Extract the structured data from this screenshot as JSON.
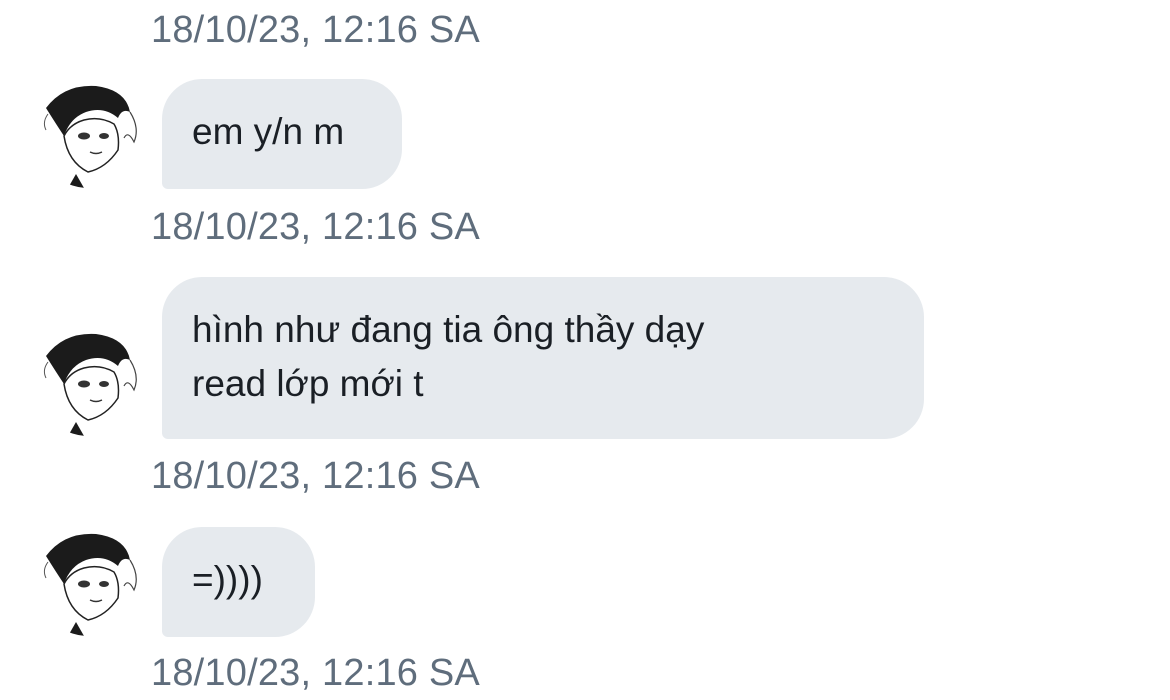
{
  "messages": [
    {
      "text": "em y/n m",
      "timestamp": "18/10/23, 12:16 SA"
    },
    {
      "text": "hình như đang tia ông thầy dạy\nread lớp mới t",
      "timestamp": "18/10/23, 12:16 SA"
    },
    {
      "text": "=))))",
      "timestamp": "18/10/23, 12:16 SA"
    }
  ],
  "top_timestamp": "18/10/23, 12:16 SA",
  "colors": {
    "bubble": "#e6eaee",
    "timestamp": "#5f6d7c",
    "text": "#1a1f25"
  },
  "avatar_icon": "manga-character-avatar"
}
